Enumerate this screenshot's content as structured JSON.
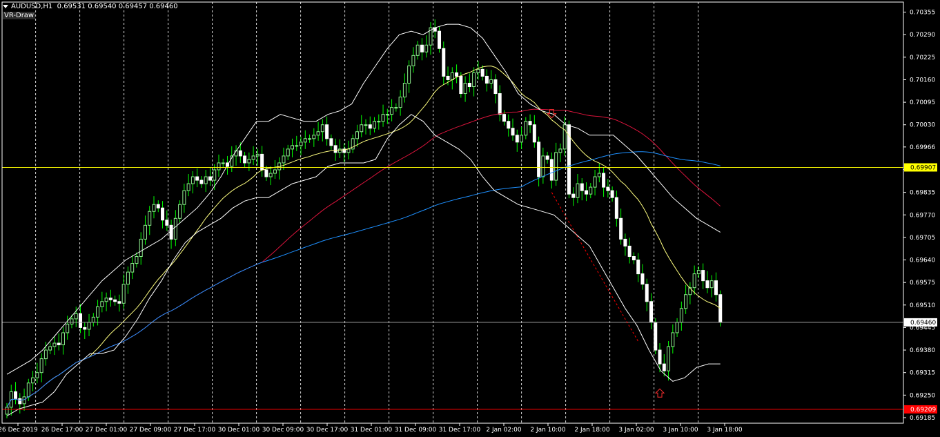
{
  "header": {
    "symbol": "AUDUSD,H1",
    "ohlc": "0.69531 0.69540 0.69457 0.69460",
    "indicator_label": "VR-Draw"
  },
  "colors": {
    "background": "#000000",
    "frame": "#ffffff",
    "candle_up": "#90ee90",
    "candle_down": "#ffffff",
    "wick": "#00ff00",
    "bollinger": "#ffffff",
    "ma_fast": "#ffff80",
    "ma_mid": "#dc143c",
    "ma_slow": "#1e90ff",
    "hline_yellow": "#ffff00",
    "hline_red": "#ff0000",
    "hline_gray": "#a0a0a0",
    "trend_line": "#ff0000",
    "arrow": "#ff3030"
  },
  "chart_data": {
    "type": "candlestick",
    "y_range": [
      0.69169,
      0.70384
    ],
    "grid": "off",
    "price_ticks": [
      "0.70355",
      "0.70290",
      "0.70225",
      "0.70160",
      "0.70095",
      "0.70030",
      "0.69966",
      "0.69901",
      "0.69835",
      "0.69770",
      "0.69705",
      "0.69640",
      "0.69575",
      "0.69510",
      "0.69445",
      "0.69380",
      "0.69315",
      "0.69250",
      "0.69185"
    ],
    "time_ticks": [
      "26 Dec 2019",
      "26 Dec 17:00",
      "27 Dec 01:00",
      "27 Dec 09:00",
      "27 Dec 17:00",
      "30 Dec 01:00",
      "30 Dec 09:00",
      "30 Dec 17:00",
      "31 Dec 01:00",
      "31 Dec 09:00",
      "31 Dec 17:00",
      "2 Jan 02:00",
      "2 Jan 10:00",
      "2 Jan 18:00",
      "3 Jan 02:00",
      "3 Jan 10:00",
      "3 Jan 18:00"
    ],
    "level_labels": [
      {
        "price": 0.69907,
        "label": "0.69907",
        "color": "#ffff00",
        "text_color": "#000000"
      },
      {
        "price": 0.6946,
        "label": "0.69460",
        "color": "#ffffff",
        "text_color": "#000000"
      },
      {
        "price": 0.69209,
        "label": "0.69209",
        "color": "#ff0000",
        "text_color": "#ffffff"
      }
    ],
    "horizontal_lines": [
      {
        "price": 0.69907,
        "color": "#ffff00"
      },
      {
        "price": 0.6946,
        "color": "#a0a0a0"
      },
      {
        "price": 0.69209,
        "color": "#ff0000"
      }
    ],
    "trend_line": {
      "from_index": 126,
      "to_index": 146,
      "from_price": 0.69835,
      "to_price": 0.69405
    },
    "arrows": [
      {
        "index": 126,
        "price": 0.7005,
        "direction": "down"
      },
      {
        "index": 151,
        "price": 0.69268,
        "direction": "up"
      }
    ],
    "closes": [
      0.69215,
      0.6926,
      0.6924,
      0.69225,
      0.69245,
      0.69285,
      0.693,
      0.69315,
      0.69355,
      0.6938,
      0.6939,
      0.694,
      0.69395,
      0.6943,
      0.69455,
      0.6947,
      0.69485,
      0.69445,
      0.6944,
      0.6946,
      0.69475,
      0.69505,
      0.6952,
      0.6953,
      0.69525,
      0.6952,
      0.69515,
      0.6957,
      0.69605,
      0.6963,
      0.6965,
      0.697,
      0.6974,
      0.6978,
      0.698,
      0.6979,
      0.69755,
      0.6974,
      0.697,
      0.6976,
      0.698,
      0.6984,
      0.6986,
      0.6988,
      0.6987,
      0.6986,
      0.6988,
      0.6987,
      0.699,
      0.6992,
      0.6992,
      0.6991,
      0.6994,
      0.69955,
      0.6994,
      0.6992,
      0.6993,
      0.6994,
      0.69945,
      0.699,
      0.6988,
      0.6989,
      0.699,
      0.6992,
      0.6994,
      0.6996,
      0.6997,
      0.6997,
      0.6998,
      0.6999,
      0.6999,
      0.7,
      0.7001,
      0.7003,
      0.6999,
      0.6997,
      0.6995,
      0.6996,
      0.6995,
      0.6996,
      0.6999,
      0.7001,
      0.7003,
      0.7003,
      0.7002,
      0.7004,
      0.7004,
      0.7006,
      0.7006,
      0.7008,
      0.7008,
      0.7011,
      0.7015,
      0.702,
      0.7023,
      0.7026,
      0.7024,
      0.7026,
      0.7031,
      0.703,
      0.7025,
      0.7017,
      0.7016,
      0.7018,
      0.7017,
      0.7012,
      0.7015,
      0.7014,
      0.7018,
      0.7019,
      0.7017,
      0.7015,
      0.7016,
      0.7012,
      0.7006,
      0.7004,
      0.7002,
      0.7,
      0.6998,
      0.7,
      0.7004,
      0.7003,
      0.6998,
      0.6988,
      0.6994,
      0.6993,
      0.6987,
      0.6995,
      0.6996,
      0.7003,
      0.6983,
      0.6982,
      0.6986,
      0.6984,
      0.6983,
      0.6985,
      0.6988,
      0.6989,
      0.6985,
      0.6984,
      0.6982,
      0.6976,
      0.697,
      0.6968,
      0.6965,
      0.6964,
      0.696,
      0.6957,
      0.6952,
      0.6946,
      0.6938,
      0.6934,
      0.6932,
      0.6939,
      0.6943,
      0.6946,
      0.695,
      0.6954,
      0.6956,
      0.696,
      0.6961,
      0.6958,
      0.6956,
      0.6958,
      0.6954,
      0.6946
    ],
    "bollinger_upper": [
      0.6931,
      0.6933,
      0.6935,
      0.6938,
      0.6942,
      0.6946,
      0.695,
      0.6954,
      0.6958,
      0.6961,
      0.6964,
      0.6966,
      0.6968,
      0.697,
      0.6973,
      0.6976,
      0.6979,
      0.6983,
      0.6988,
      0.6994,
      0.6999,
      0.7004,
      0.7004,
      0.7006,
      0.7005,
      0.7004,
      0.7004,
      0.7006,
      0.7007,
      0.7009,
      0.7015,
      0.702,
      0.7025,
      0.7029,
      0.703,
      0.7029,
      0.7031,
      0.7032,
      0.7032,
      0.7031,
      0.7028,
      0.7023,
      0.7018,
      0.7012,
      0.7009,
      0.7007,
      0.7006,
      0.7003,
      0.7002,
      0.7,
      0.7,
      0.7,
      0.6997,
      0.6994,
      0.699,
      0.6986,
      0.6982,
      0.6979,
      0.6976,
      0.6974,
      0.6972
    ],
    "bollinger_lower": [
      0.6919,
      0.6921,
      0.6922,
      0.6923,
      0.6926,
      0.6931,
      0.6934,
      0.6937,
      0.6937,
      0.6938,
      0.6942,
      0.6947,
      0.6953,
      0.6958,
      0.6964,
      0.6969,
      0.6972,
      0.6974,
      0.6976,
      0.6979,
      0.6981,
      0.6982,
      0.6982,
      0.6984,
      0.6986,
      0.6987,
      0.6988,
      0.6991,
      0.6992,
      0.6992,
      0.6992,
      0.6993,
      0.6999,
      0.7003,
      0.7006,
      0.7004,
      0.7,
      0.6998,
      0.6996,
      0.6993,
      0.6988,
      0.6984,
      0.6982,
      0.698,
      0.6979,
      0.6978,
      0.6977,
      0.6974,
      0.6971,
      0.6968,
      0.6962,
      0.6956,
      0.695,
      0.6945,
      0.6938,
      0.6932,
      0.6929,
      0.693,
      0.6933,
      0.6934,
      0.6934
    ]
  }
}
